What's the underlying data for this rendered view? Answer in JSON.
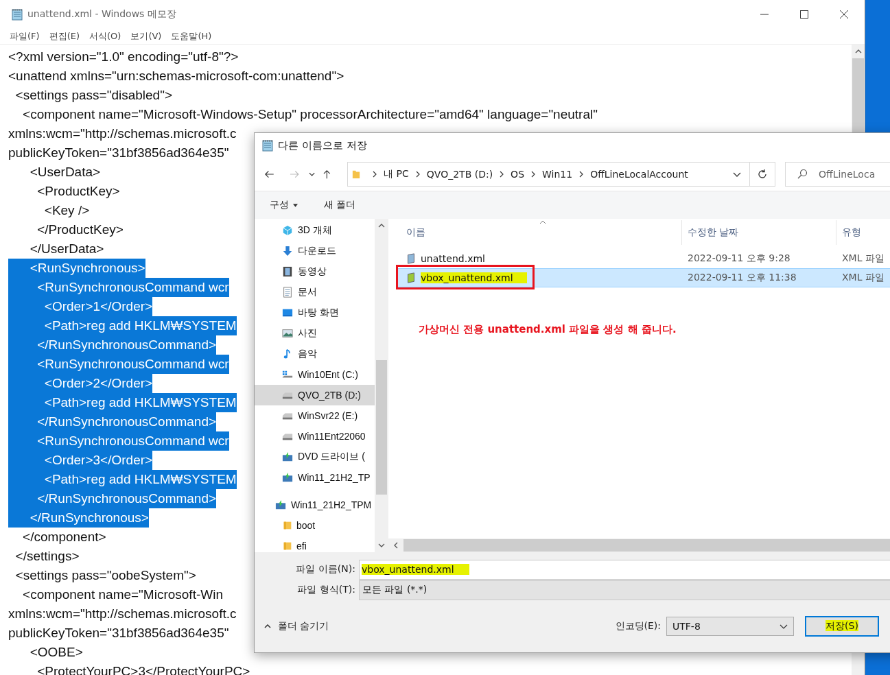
{
  "notepad": {
    "title": "unattend.xml - Windows 메모장",
    "menu": [
      "파일(F)",
      "편집(E)",
      "서식(O)",
      "보기(V)",
      "도움말(H)"
    ],
    "lines": [
      {
        "text": "<?xml version=\"1.0\" encoding=\"utf-8\"?>",
        "selected": false
      },
      {
        "text": "<unattend xmlns=\"urn:schemas-microsoft-com:unattend\">",
        "selected": false
      },
      {
        "text": "  <settings pass=\"disabled\">",
        "selected": false
      },
      {
        "text": "    <component name=\"Microsoft-Windows-Setup\" processorArchitecture=\"amd64\" language=\"neutral\"",
        "selected": false
      },
      {
        "text": "xmlns:wcm=\"http://schemas.microsoft.c",
        "selected": false
      },
      {
        "text": "publicKeyToken=\"31bf3856ad364e35\"",
        "selected": false
      },
      {
        "text": "      <UserData>",
        "selected": false
      },
      {
        "text": "        <ProductKey>",
        "selected": false
      },
      {
        "text": "          <Key />",
        "selected": false
      },
      {
        "text": "        </ProductKey>",
        "selected": false
      },
      {
        "text": "      </UserData>",
        "selected": false
      },
      {
        "text": "      <RunSynchronous>",
        "selected": true
      },
      {
        "text": "        <RunSynchronousCommand wcr",
        "selected": true
      },
      {
        "text": "          <Order>1</Order>",
        "selected": true
      },
      {
        "text": "          <Path>reg add HKLM₩SYSTEM",
        "selected": true
      },
      {
        "text": "        </RunSynchronousCommand>",
        "selected": true
      },
      {
        "text": "        <RunSynchronousCommand wcr",
        "selected": true
      },
      {
        "text": "          <Order>2</Order>",
        "selected": true
      },
      {
        "text": "          <Path>reg add HKLM₩SYSTEM",
        "selected": true
      },
      {
        "text": "        </RunSynchronousCommand>",
        "selected": true
      },
      {
        "text": "        <RunSynchronousCommand wcr",
        "selected": true
      },
      {
        "text": "          <Order>3</Order>",
        "selected": true
      },
      {
        "text": "          <Path>reg add HKLM₩SYSTEM",
        "selected": true
      },
      {
        "text": "        </RunSynchronousCommand>",
        "selected": true
      },
      {
        "text": "      </RunSynchronous>",
        "selected": true
      },
      {
        "text": "    </component>",
        "selected": false
      },
      {
        "text": "  </settings>",
        "selected": false
      },
      {
        "text": "  <settings pass=\"oobeSystem\">",
        "selected": false
      },
      {
        "text": "    <component name=\"Microsoft-Win",
        "selected": false
      },
      {
        "text": "xmlns:wcm=\"http://schemas.microsoft.c",
        "selected": false
      },
      {
        "text": "publicKeyToken=\"31bf3856ad364e35\"",
        "selected": false
      },
      {
        "text": "      <OOBE>",
        "selected": false
      },
      {
        "text": "        <ProtectYourPC>3</ProtectYourPC>",
        "selected": false
      }
    ]
  },
  "save_dialog": {
    "title": "다른 이름으로 저장",
    "breadcrumbs": [
      "내 PC",
      "QVO_2TB (D:)",
      "OS",
      "Win11",
      "OffLineLocalAccount"
    ],
    "search": {
      "placeholder": "OffLineLoca"
    },
    "toolbar": [
      "구성",
      "새 폴더"
    ],
    "nav": [
      {
        "label": "3D 개체",
        "kind": "objects3d",
        "selected": false
      },
      {
        "label": "다운로드",
        "kind": "download",
        "selected": false
      },
      {
        "label": "동영상",
        "kind": "video",
        "selected": false
      },
      {
        "label": "문서",
        "kind": "document",
        "selected": false
      },
      {
        "label": "바탕 화면",
        "kind": "desktop",
        "selected": false
      },
      {
        "label": "사진",
        "kind": "pictures",
        "selected": false
      },
      {
        "label": "음악",
        "kind": "music",
        "selected": false
      },
      {
        "label": "Win10Ent (C:)",
        "kind": "system-drive",
        "selected": false
      },
      {
        "label": "QVO_2TB (D:)",
        "kind": "drive",
        "selected": true
      },
      {
        "label": "WinSvr22 (E:)",
        "kind": "drive",
        "selected": false
      },
      {
        "label": "Win11Ent22060",
        "kind": "drive",
        "selected": false
      },
      {
        "label": "DVD 드라이브 (",
        "kind": "dvd",
        "selected": false
      },
      {
        "label": "Win11_21H2_TP",
        "kind": "dvd",
        "selected": false
      },
      {
        "label": "Win11_21H2_TPM",
        "kind": "dvd",
        "selected": false,
        "children": [
          {
            "label": "boot",
            "kind": "folder",
            "selected": false
          },
          {
            "label": "efi",
            "kind": "folder",
            "selected": false
          }
        ]
      }
    ],
    "columns": [
      "이름",
      "수정한 날짜",
      "유형"
    ],
    "files": [
      {
        "name": "unattend.xml",
        "modified": "2022-09-11 오후 9:28",
        "type": "XML 파일",
        "selected": false,
        "highlighted": false,
        "boxed": false
      },
      {
        "name": "vbox_unattend.xml",
        "modified": "2022-09-11 오후 11:38",
        "type": "XML 파일",
        "selected": true,
        "highlighted": true,
        "boxed": true
      }
    ],
    "annotation": "가상머신 전용 unattend.xml 파일을 생성 해 줍니다.",
    "filename": {
      "label": "파일 이름(N):",
      "value": "vbox_unattend.xml",
      "highlighted": true
    },
    "filetype": {
      "label": "파일 형식(T):",
      "value": "모든 파일 (*.*)"
    },
    "hide_folders": "폴더 숨기기",
    "encoding": {
      "label": "인코딩(E):",
      "value": "UTF-8"
    },
    "save_button": {
      "label": "저장(S)",
      "highlighted": true
    }
  }
}
